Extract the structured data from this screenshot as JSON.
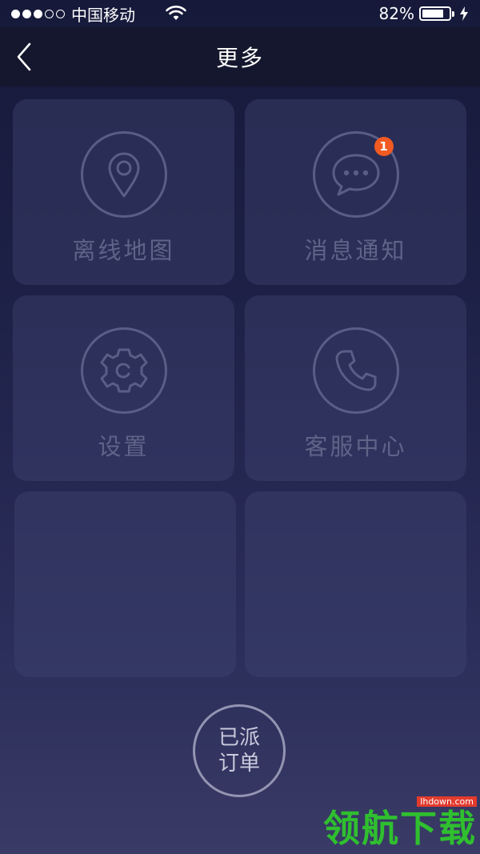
{
  "status_bar": {
    "carrier": "中国移动",
    "battery_percent_text": "82%",
    "battery_level": 0.82,
    "signal_strength": 3,
    "signal_max": 5
  },
  "nav": {
    "title": "更多",
    "back_icon": "chevron-left-icon"
  },
  "tiles": [
    {
      "label": "离线地图",
      "icon": "map-pin-icon"
    },
    {
      "label": "消息通知",
      "icon": "chat-bubble-icon",
      "badge": "1"
    },
    {
      "label": "设置",
      "icon": "gear-icon"
    },
    {
      "label": "客服中心",
      "icon": "phone-icon"
    },
    {
      "label": "",
      "icon": ""
    },
    {
      "label": "",
      "icon": ""
    }
  ],
  "fab": {
    "line1": "已派",
    "line2": "订单"
  },
  "watermark": {
    "url": "lhdown.com",
    "text": "领航下载"
  },
  "colors": {
    "badge": "#f15a22",
    "tile_icon": "#5a5e86",
    "tile_label": "#5f6388"
  }
}
